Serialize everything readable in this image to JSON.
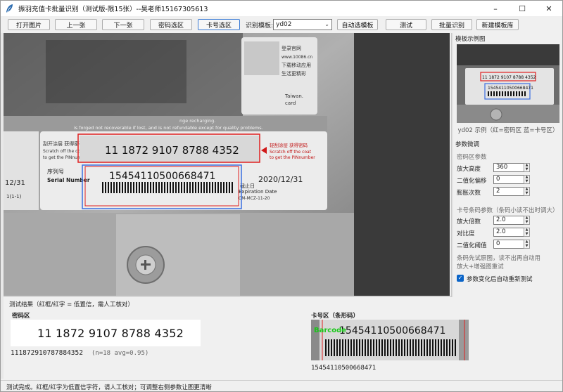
{
  "window": {
    "title": "振羽充值卡批量识别（测试版-限15张）--吴老师15167305613",
    "controls": {
      "minimize": "–",
      "maximize": "☐",
      "close": "✕"
    }
  },
  "toolbar": {
    "open_label": "打开图片",
    "prev_label": "上一张",
    "next_label": "下一张",
    "pw_select_label": "密码选区",
    "card_select_label": "卡号选区",
    "template_label": "识别模板:",
    "template_value": "yd02",
    "auto_select_label": "自动选模板",
    "test_label": "测试",
    "batch_label": "批量识别",
    "new_template_label": "新建模板库"
  },
  "card_image": {
    "top_label_lines": [
      "登录官网",
      "www.10086.cn",
      "下载移动应用",
      "生活更精彩"
    ],
    "taiwan_lines": [
      "Taiwan.",
      "card"
    ],
    "recharge_text": "nge recharging.",
    "disclaimer": "is forged not recoverable if lost, and is not refundable except for quality problems.",
    "scratch_cn": "刮开涂层 获得密码",
    "scratch_en1": "Scratch off the coat",
    "scratch_en2": "to get the PINnumber",
    "scratch_right_cn": "轻刮涂层 获得密码",
    "scratch_right_en1": "Scratch off the coat",
    "scratch_right_en2": "to get the PINnumber",
    "password": "11 1872 9107 8788 4352",
    "serial_cn": "序列号",
    "serial_en": "Serial Number",
    "serial": "15454110500668471",
    "expiry_date": "2020/12/31",
    "expiry_cn": "截止日",
    "expiry_en": "Expiration Date",
    "expiry_code": "CM-MCZ-11-20",
    "left_date": "12/31",
    "left_code": "1(1-1)"
  },
  "panel": {
    "example_heading": "模板示例图",
    "example_caption": "yd02 示例（红=密码区 蓝=卡号区）",
    "preview_pw": "11 1872 9107 8788 4352",
    "preview_serial": "15454110500668471",
    "tune_heading": "参数微调",
    "pw_params_heading": "密码区参数",
    "params": [
      {
        "label": "放大高度",
        "value": "360"
      },
      {
        "label": "二值化偏移",
        "value": "0"
      },
      {
        "label": "膨胀次数",
        "value": "2"
      }
    ],
    "bc_params_heading": "卡号条码参数（条码小读不出时调大）",
    "bc_params": [
      {
        "label": "放大倍数",
        "value": "2.0"
      },
      {
        "label": "对比度",
        "value": "2.0"
      },
      {
        "label": "二值化阈值",
        "value": "0"
      }
    ],
    "hint_line1": "条码先试原图，读不出再自动用",
    "hint_line2": "放大+增强图重试",
    "auto_retest_label": "参数变化后自动重新测试",
    "auto_retest_checked": "✓"
  },
  "results": {
    "title": "测试结果（红框/红字 = 低置信，需人工核对）",
    "pw_heading": "密码区",
    "pw_crop_text": "11 1872 9107 8788 4352",
    "pw_value": "111872910787884352",
    "pw_meta": "(n=18  avg=0.95)",
    "bc_heading": "卡号区（条形码）",
    "bc_overlay": "Barcode",
    "bc_crop_digits": "15454110500668471",
    "bc_value": "15454110500668471"
  },
  "status": {
    "text": "测试完成。红框/红字为低置信字符，请人工核对；可调整右侧参数让图更清晰"
  },
  "colors": {
    "pw_box": "#e02020",
    "serial_box": "#3a6ee0",
    "barcode_overlay": "#18c818",
    "checkbox": "#0a64c8"
  }
}
